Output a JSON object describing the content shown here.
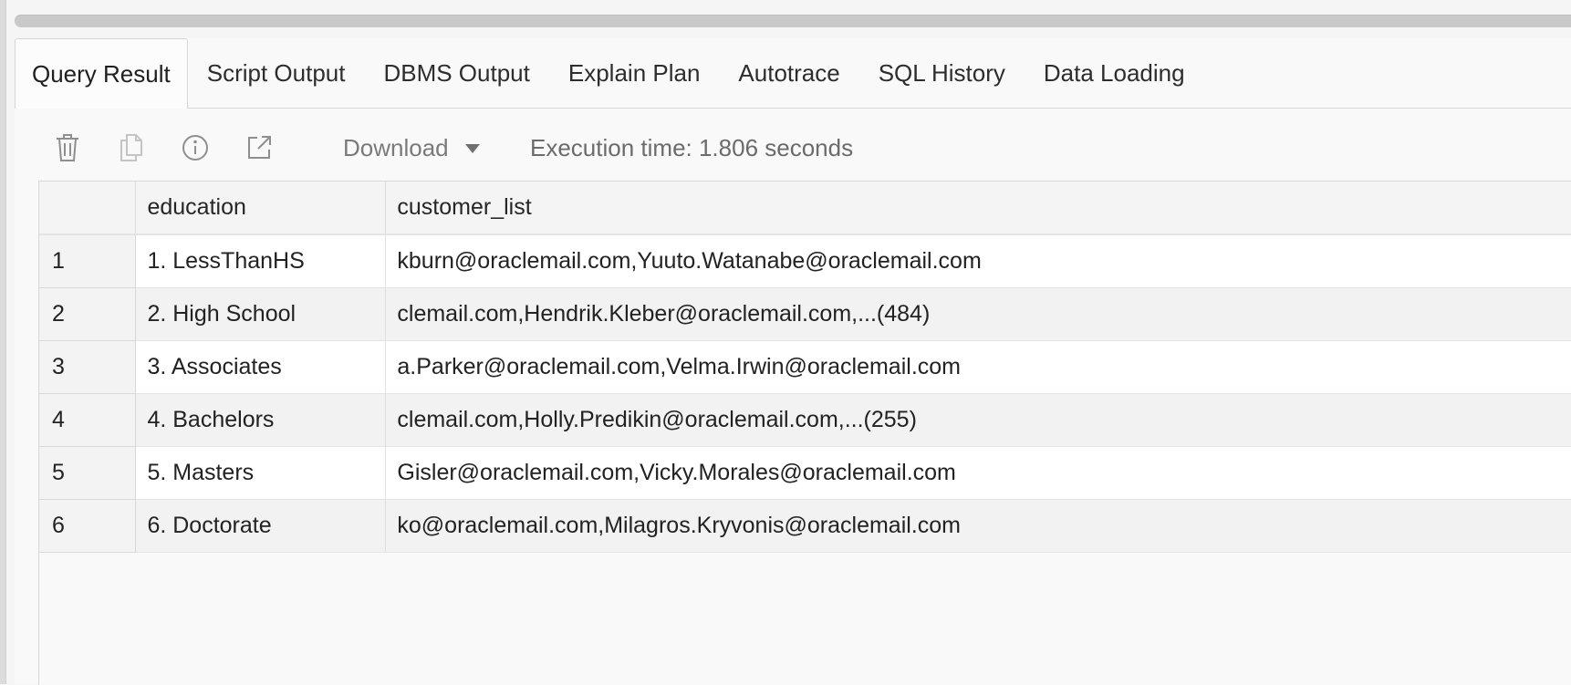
{
  "tabs": [
    {
      "label": "Query Result",
      "active": true
    },
    {
      "label": "Script Output",
      "active": false
    },
    {
      "label": "DBMS Output",
      "active": false
    },
    {
      "label": "Explain Plan",
      "active": false
    },
    {
      "label": "Autotrace",
      "active": false
    },
    {
      "label": "SQL History",
      "active": false
    },
    {
      "label": "Data Loading",
      "active": false
    }
  ],
  "toolbar": {
    "icons": [
      "trash-icon",
      "copy-icon",
      "info-icon",
      "open-external-icon"
    ],
    "download_label": "Download",
    "execution_time": "Execution time: 1.806 seconds"
  },
  "grid": {
    "columns": [
      "education",
      "customer_list"
    ],
    "rows": [
      {
        "num": "1",
        "education": "1. LessThanHS",
        "customer_list": "kburn@oraclemail.com,Yuuto.Watanabe@oraclemail.com"
      },
      {
        "num": "2",
        "education": "2. High School",
        "customer_list": "clemail.com,Hendrik.Kleber@oraclemail.com,...(484)"
      },
      {
        "num": "3",
        "education": "3. Associates",
        "customer_list": "a.Parker@oraclemail.com,Velma.Irwin@oraclemail.com"
      },
      {
        "num": "4",
        "education": "4. Bachelors",
        "customer_list": "clemail.com,Holly.Predikin@oraclemail.com,...(255)"
      },
      {
        "num": "5",
        "education": "5. Masters",
        "customer_list": "Gisler@oraclemail.com,Vicky.Morales@oraclemail.com"
      },
      {
        "num": "6",
        "education": "6. Doctorate",
        "customer_list": "ko@oraclemail.com,Milagros.Kryvonis@oraclemail.com"
      }
    ]
  },
  "colors": {
    "active_tab_bg": "#fcfcfc",
    "row_alt_bg": "#f2f2f2",
    "icon_gray": "#9a9a9a"
  }
}
